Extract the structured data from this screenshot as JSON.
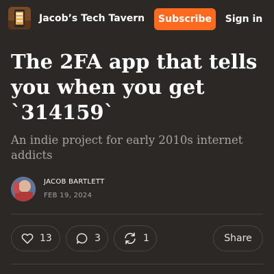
{
  "header": {
    "publication_name": "Jacob’s Tech Tavern",
    "subscribe_label": "Subscribe",
    "signin_label": "Sign in"
  },
  "post": {
    "title": "The 2FA app that tells you when you get `314159`",
    "subtitle": "An indie project for early 2010s internet addicts",
    "author": "JACOB BARTLETT",
    "date": "FEB 19, 2024"
  },
  "actions": {
    "likes": "13",
    "comments": "3",
    "restacks": "1",
    "share_label": "Share"
  },
  "colors": {
    "background": "#2b2826",
    "accent": "#fb6a1f",
    "muted_text": "#a8a4a0"
  },
  "icons": {
    "like": "heart-icon",
    "comment": "comment-bubble-icon",
    "restack": "restack-arrows-icon"
  }
}
